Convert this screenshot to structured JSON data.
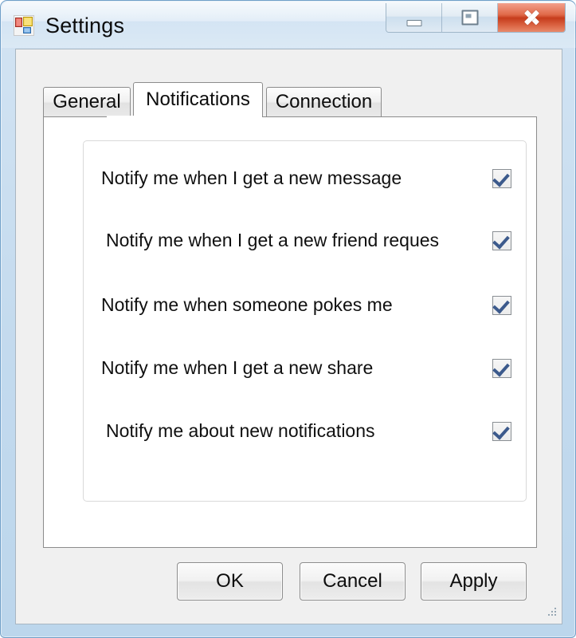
{
  "window": {
    "title": "Settings",
    "icon": "windows-forms-app-icon",
    "controls": [
      {
        "name": "minimize",
        "glyph": "minimize-icon"
      },
      {
        "name": "maximize",
        "glyph": "maximize-icon"
      },
      {
        "name": "close",
        "glyph": "close-icon"
      }
    ]
  },
  "tabs": [
    {
      "label": "General",
      "selected": false
    },
    {
      "label": "Notifications",
      "selected": true
    },
    {
      "label": "Connection",
      "selected": false
    }
  ],
  "options": [
    {
      "label": "Notify me when I get a new message",
      "checked": true,
      "indent": 22
    },
    {
      "label": "Notify me when I get a new friend reques",
      "checked": true,
      "indent": 28
    },
    {
      "label": "Notify me when someone pokes me",
      "checked": true,
      "indent": 22
    },
    {
      "label": "Notify me when I get a new share",
      "checked": true,
      "indent": 22
    },
    {
      "label": "Notify me about new notifications",
      "checked": true,
      "indent": 28
    }
  ],
  "buttons": {
    "ok": "OK",
    "cancel": "Cancel",
    "apply": "Apply"
  },
  "colors": {
    "frame": "#c3daee",
    "client": "#f0f0f0",
    "close_button": "#c63c1c",
    "check_mark": "#3c5a8c",
    "tab_border": "#8c8c8c"
  }
}
